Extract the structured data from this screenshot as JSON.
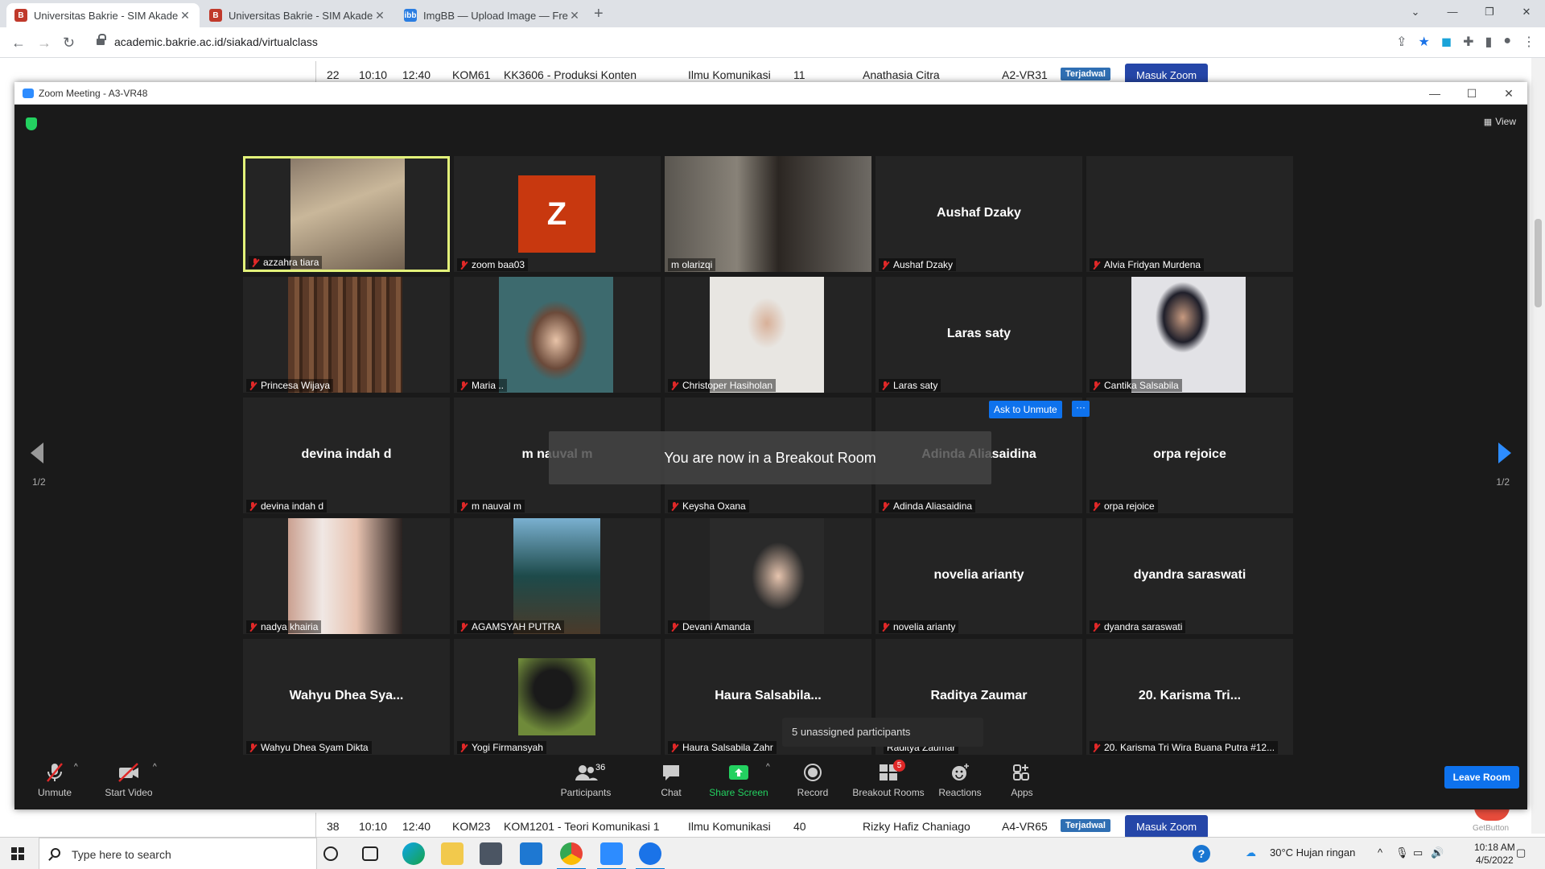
{
  "browser": {
    "tabs": [
      {
        "title": "Universitas Bakrie - SIM Akadem",
        "favicon": "bakrie-logo-icon"
      },
      {
        "title": "Universitas Bakrie - SIM Akadem",
        "favicon": "bakrie-logo-icon"
      },
      {
        "title": "ImgBB — Upload Image — Free",
        "favicon": "imgbb-logo-icon"
      }
    ],
    "url": "academic.bakrie.ac.id/siakad/virtualclass"
  },
  "page": {
    "rows": [
      {
        "no": "22",
        "start": "10:10",
        "end": "12:40",
        "code": "KOM61",
        "course": "KK3606 - Produksi Konten",
        "program": "Ilmu Komunikasi",
        "count": "11",
        "lecturer": "Anathasia Citra",
        "room": "A2-VR31",
        "status": "Terjadwal",
        "action": "Masuk Zoom"
      },
      {
        "no": "38",
        "start": "10:10",
        "end": "12:40",
        "code": "KOM23",
        "course": "KOM1201 - Teori Komunikasi 1",
        "program": "Ilmu Komunikasi",
        "count": "40",
        "lecturer": "Rizky Hafiz Chaniago",
        "room": "A4-VR65",
        "status": "Terjadwal",
        "action": "Masuk Zoom"
      }
    ],
    "corner_button_label": "GetButton"
  },
  "zoom": {
    "window_title": "Zoom Meeting - A3-VR48",
    "view_label": "View",
    "page_indicator": "1/2",
    "breakout_message": "You are now in a Breakout Room",
    "ask_unmute_label": "Ask to Unmute",
    "more_label": "···",
    "unassigned_label": "5 unassigned participants",
    "tiles": [
      {
        "name": "azzahra tiara",
        "big": "",
        "video": "photo"
      },
      {
        "name": "zoom baa03",
        "big": "",
        "video": "avatar",
        "avatar_letter": "Z"
      },
      {
        "name": "m olarizqi",
        "big": "",
        "video": "photo"
      },
      {
        "name": "Aushaf Dzaky",
        "big": "Aushaf Dzaky",
        "video": "none"
      },
      {
        "name": "Alvia Fridyan Murdena",
        "big": "",
        "video": "none"
      },
      {
        "name": "Princesa Wijaya",
        "big": "",
        "video": "photo"
      },
      {
        "name": "Maria ..",
        "big": "",
        "video": "photo"
      },
      {
        "name": "Christoper Hasiholan",
        "big": "",
        "video": "photo"
      },
      {
        "name": "Laras saty",
        "big": "Laras saty",
        "video": "none"
      },
      {
        "name": "Cantika Salsabila",
        "big": "",
        "video": "photo"
      },
      {
        "name": "devina indah d",
        "big": "devina indah d",
        "video": "none"
      },
      {
        "name": "m nauval m",
        "big": "m nauval m",
        "video": "none"
      },
      {
        "name": "Keysha Oxana",
        "big": "",
        "video": "none"
      },
      {
        "name": "Adinda Aliasaidina",
        "big": "Adinda Aliasaidina",
        "video": "none"
      },
      {
        "name": "orpa rejoice",
        "big": "orpa rejoice",
        "video": "none"
      },
      {
        "name": "nadya khairia",
        "big": "",
        "video": "photo"
      },
      {
        "name": "AGAMSYAH PUTRA",
        "big": "",
        "video": "photo"
      },
      {
        "name": "Devani Amanda",
        "big": "",
        "video": "photo"
      },
      {
        "name": "novelia arianty",
        "big": "novelia arianty",
        "video": "none"
      },
      {
        "name": "dyandra saraswati",
        "big": "dyandra saraswati",
        "video": "none"
      },
      {
        "name": "Wahyu Dhea Syam Dikta",
        "big": "Wahyu  Dhea  Sya...",
        "video": "none"
      },
      {
        "name": "Yogi Firmansyah",
        "big": "",
        "video": "photo"
      },
      {
        "name": "Haura Salsabila Zahr",
        "big": "Haura  Salsabila...",
        "video": "none"
      },
      {
        "name": "Raditya Zaumar",
        "big": "Raditya Zaumar",
        "video": "none"
      },
      {
        "name": "20. Karisma Tri Wira Buana Putra #12...",
        "big": "20. Karisma  Tri...",
        "video": "none"
      }
    ],
    "controls": {
      "unmute": "Unmute",
      "start_video": "Start Video",
      "participants": "Participants",
      "participants_count": "36",
      "chat": "Chat",
      "share_screen": "Share Screen",
      "record": "Record",
      "breakout_rooms": "Breakout Rooms",
      "breakout_badge": "5",
      "reactions": "Reactions",
      "apps": "Apps",
      "leave_room": "Leave Room"
    }
  },
  "taskbar": {
    "search_placeholder": "Type here to search",
    "weather": "30°C  Hujan ringan",
    "time": "10:18 AM",
    "date": "4/5/2022"
  },
  "colors": {
    "zoom_blue": "#0e72ed",
    "active_speaker": "#e3f27a",
    "muted_red": "#e02828",
    "share_green": "#23d160",
    "status_badge": "#2f6fb3"
  }
}
